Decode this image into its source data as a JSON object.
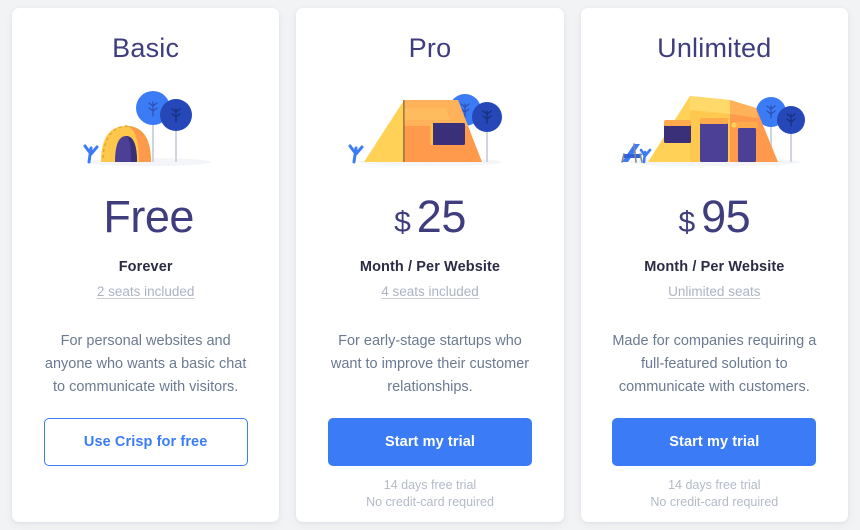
{
  "page": {
    "background_color": "#f2f3f5",
    "card_color": "#ffffff",
    "accent_color": "#3b7cf6",
    "price_color": "#3f3d7e",
    "muted_color": "#b3bac8"
  },
  "plans": [
    {
      "id": "basic",
      "title": "Basic",
      "illustration": "small-dome-tent-illustration",
      "price_currency": "",
      "price_amount": "Free",
      "price_is_word": true,
      "period": "Forever",
      "seats": "2 seats included",
      "description": "For personal websites and anyone who wants a basic chat to communicate with visitors.",
      "cta_label": "Use Crisp for free",
      "cta_style": "outline",
      "footnote_lines": []
    },
    {
      "id": "pro",
      "title": "Pro",
      "illustration": "a-frame-tent-illustration",
      "price_currency": "$",
      "price_amount": "25",
      "price_is_word": false,
      "period": "Month / Per Website",
      "seats": "4 seats included",
      "description": "For early-stage startups who want to improve their customer relationships.",
      "cta_label": "Start my trial",
      "cta_style": "filled",
      "footnote_lines": [
        "14 days free trial",
        "No credit-card required"
      ]
    },
    {
      "id": "unlimited",
      "title": "Unlimited",
      "illustration": "large-camp-tent-illustration",
      "price_currency": "$",
      "price_amount": "95",
      "price_is_word": false,
      "period": "Month / Per Website",
      "seats": "Unlimited seats",
      "description": "Made for companies requiring a full-featured solution to communicate with customers.",
      "cta_label": "Start my trial",
      "cta_style": "filled",
      "footnote_lines": [
        "14 days free trial",
        "No credit-card required"
      ]
    }
  ]
}
